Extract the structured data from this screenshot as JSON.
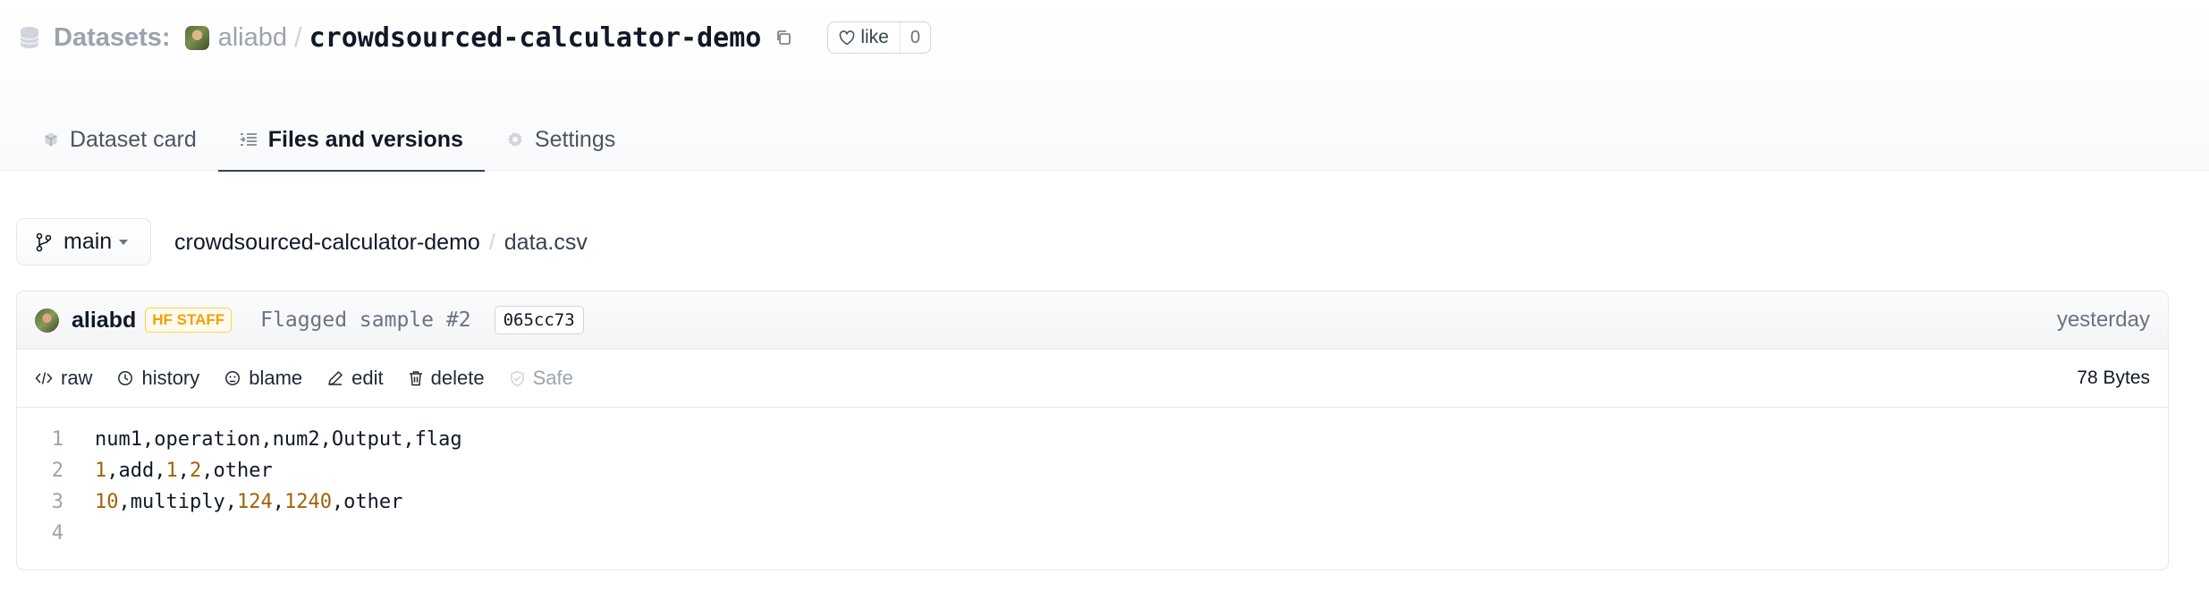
{
  "header": {
    "section_label": "Datasets:",
    "owner": "aliabd",
    "separator": "/",
    "repo": "crowdsourced-calculator-demo",
    "like_label": "like",
    "like_count": "0"
  },
  "tabs": [
    {
      "label": "Dataset card",
      "icon": "dataset-card-icon",
      "active": false
    },
    {
      "label": "Files and versions",
      "icon": "files-icon",
      "active": true
    },
    {
      "label": "Settings",
      "icon": "gear-icon",
      "active": false
    }
  ],
  "branch": {
    "name": "main"
  },
  "breadcrumb": {
    "repo": "crowdsourced-calculator-demo",
    "separator": "/",
    "file": "data.csv"
  },
  "commit": {
    "author": "aliabd",
    "badge": "HF STAFF",
    "message": "Flagged sample #2",
    "hash": "065cc73",
    "time": "yesterday"
  },
  "actions": [
    {
      "label": "raw",
      "icon": "code-icon"
    },
    {
      "label": "history",
      "icon": "clock-icon"
    },
    {
      "label": "blame",
      "icon": "blame-icon"
    },
    {
      "label": "edit",
      "icon": "pencil-icon"
    },
    {
      "label": "delete",
      "icon": "trash-icon"
    },
    {
      "label": "Safe",
      "icon": "shield-check-icon"
    }
  ],
  "file_size": "78 Bytes",
  "code_lines": [
    {
      "number": "1",
      "tokens": [
        {
          "t": "num1,operation,num2,Output,flag",
          "k": "text"
        }
      ]
    },
    {
      "number": "2",
      "tokens": [
        {
          "t": "1",
          "k": "num"
        },
        {
          "t": ",add,",
          "k": "text"
        },
        {
          "t": "1",
          "k": "num"
        },
        {
          "t": ",",
          "k": "text"
        },
        {
          "t": "2",
          "k": "num"
        },
        {
          "t": ",other",
          "k": "text"
        }
      ]
    },
    {
      "number": "3",
      "tokens": [
        {
          "t": "10",
          "k": "num"
        },
        {
          "t": ",multiply,",
          "k": "text"
        },
        {
          "t": "124",
          "k": "num"
        },
        {
          "t": ",",
          "k": "text"
        },
        {
          "t": "1240",
          "k": "num"
        },
        {
          "t": ",other",
          "k": "text"
        }
      ]
    },
    {
      "number": "4",
      "tokens": []
    }
  ],
  "colors": {
    "accent": "#374151",
    "badge": "#f59e0b",
    "number_token": "#a16207"
  }
}
